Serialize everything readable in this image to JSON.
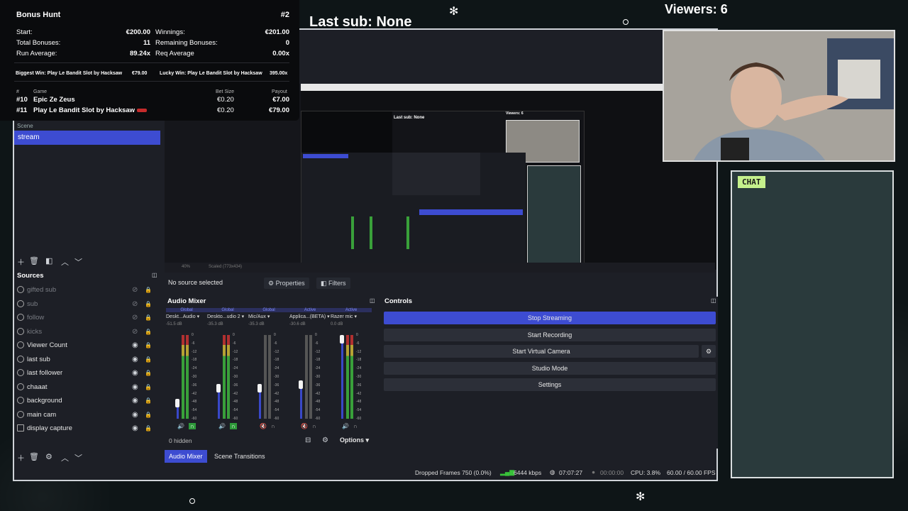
{
  "overlay": {
    "bonus_hunt": {
      "title": "Bonus Hunt",
      "number": "#2",
      "start_label": "Start:",
      "start_value": "€200.00",
      "winnings_label": "Winnings:",
      "winnings_value": "€201.00",
      "total_label": "Total Bonuses:",
      "total_value": "11",
      "remaining_label": "Remaining Bonuses:",
      "remaining_value": "0",
      "run_avg_label": "Run Average:",
      "run_avg_value": "89.24x",
      "req_avg_label": "Req Average",
      "req_avg_value": "0.00x",
      "biggest_win": "Biggest Win: Play Le Bandit Slot by Hacksaw",
      "biggest_win_amount": "€79.00",
      "lucky_win": "Lucky Win: Play Le Bandit Slot by Hacksaw",
      "lucky_win_amount": "395.00x",
      "col_hash": "#",
      "col_game": "Game",
      "col_bet": "Bet Size",
      "col_payout": "Payout",
      "rows": [
        {
          "num": "#10",
          "game": "Epic Ze Zeus",
          "bet": "€0.20",
          "payout": "€7.00"
        },
        {
          "num": "#11",
          "game": "Play Le Bandit Slot by Hacksaw",
          "bet": "€0.20",
          "payout": "€79.00"
        }
      ]
    },
    "last_sub": "Last sub: None",
    "viewers": "Viewers: 6",
    "chat_label": "CHAT"
  },
  "scenes": {
    "header_label": "Scene",
    "items": [
      "stream"
    ]
  },
  "sources": {
    "header": "Sources",
    "items": [
      {
        "name": "gifted sub",
        "visible": false
      },
      {
        "name": "sub",
        "visible": false
      },
      {
        "name": "follow",
        "visible": false
      },
      {
        "name": "kicks",
        "visible": false
      },
      {
        "name": "Viewer Count",
        "visible": true
      },
      {
        "name": "last sub",
        "visible": true
      },
      {
        "name": "last follower",
        "visible": true
      },
      {
        "name": "chaaat",
        "visible": true
      },
      {
        "name": "background",
        "visible": true
      },
      {
        "name": "main cam",
        "visible": true
      },
      {
        "name": "display capture",
        "visible": true
      }
    ]
  },
  "preview_toolbar": {
    "no_source": "No source selected",
    "properties": "Properties",
    "filters": "Filters",
    "zoom": "40%",
    "scaled": "Scaled (773x434)"
  },
  "mixer": {
    "header": "Audio Mixer",
    "channels": [
      {
        "tag": "Global",
        "name": "Deskt...Audio",
        "db": "-51.5 dB",
        "level": 0.15
      },
      {
        "tag": "Global",
        "name": "Deskto...udio 2",
        "db": "-35.3 dB",
        "level": 0.35
      },
      {
        "tag": "Global",
        "name": "Mic/Aux",
        "db": "-35.3 dB",
        "level": 0.35
      },
      {
        "tag": "Active",
        "name": "Applica...(BETA)",
        "db": "-30.6 dB",
        "level": 0.4
      },
      {
        "tag": "Active",
        "name": "Razer mic",
        "db": "0.0 dB",
        "level": 1.0
      }
    ],
    "scale": [
      "0",
      "-6",
      "-12",
      "-18",
      "-24",
      "-30",
      "-36",
      "-42",
      "-48",
      "-54",
      "-60"
    ],
    "hidden": "0 hidden",
    "options": "Options"
  },
  "dock_tabs": [
    "Audio Mixer",
    "Scene Transitions"
  ],
  "controls": {
    "header": "Controls",
    "buttons": [
      "Stop Streaming",
      "Start Recording",
      "Start Virtual Camera",
      "Studio Mode",
      "Settings"
    ]
  },
  "status": {
    "dropped": "Dropped Frames 750 (0.0%)",
    "bitrate": "6444 kbps",
    "stream_time": "07:07:27",
    "rec_time": "00:00:00",
    "cpu": "CPU: 3.8%",
    "fps": "60.00 / 60.00 FPS"
  },
  "colors": {
    "accent": "#3d4cd1",
    "panel": "#1d1f26",
    "chat_badge": "#c5f08c"
  }
}
